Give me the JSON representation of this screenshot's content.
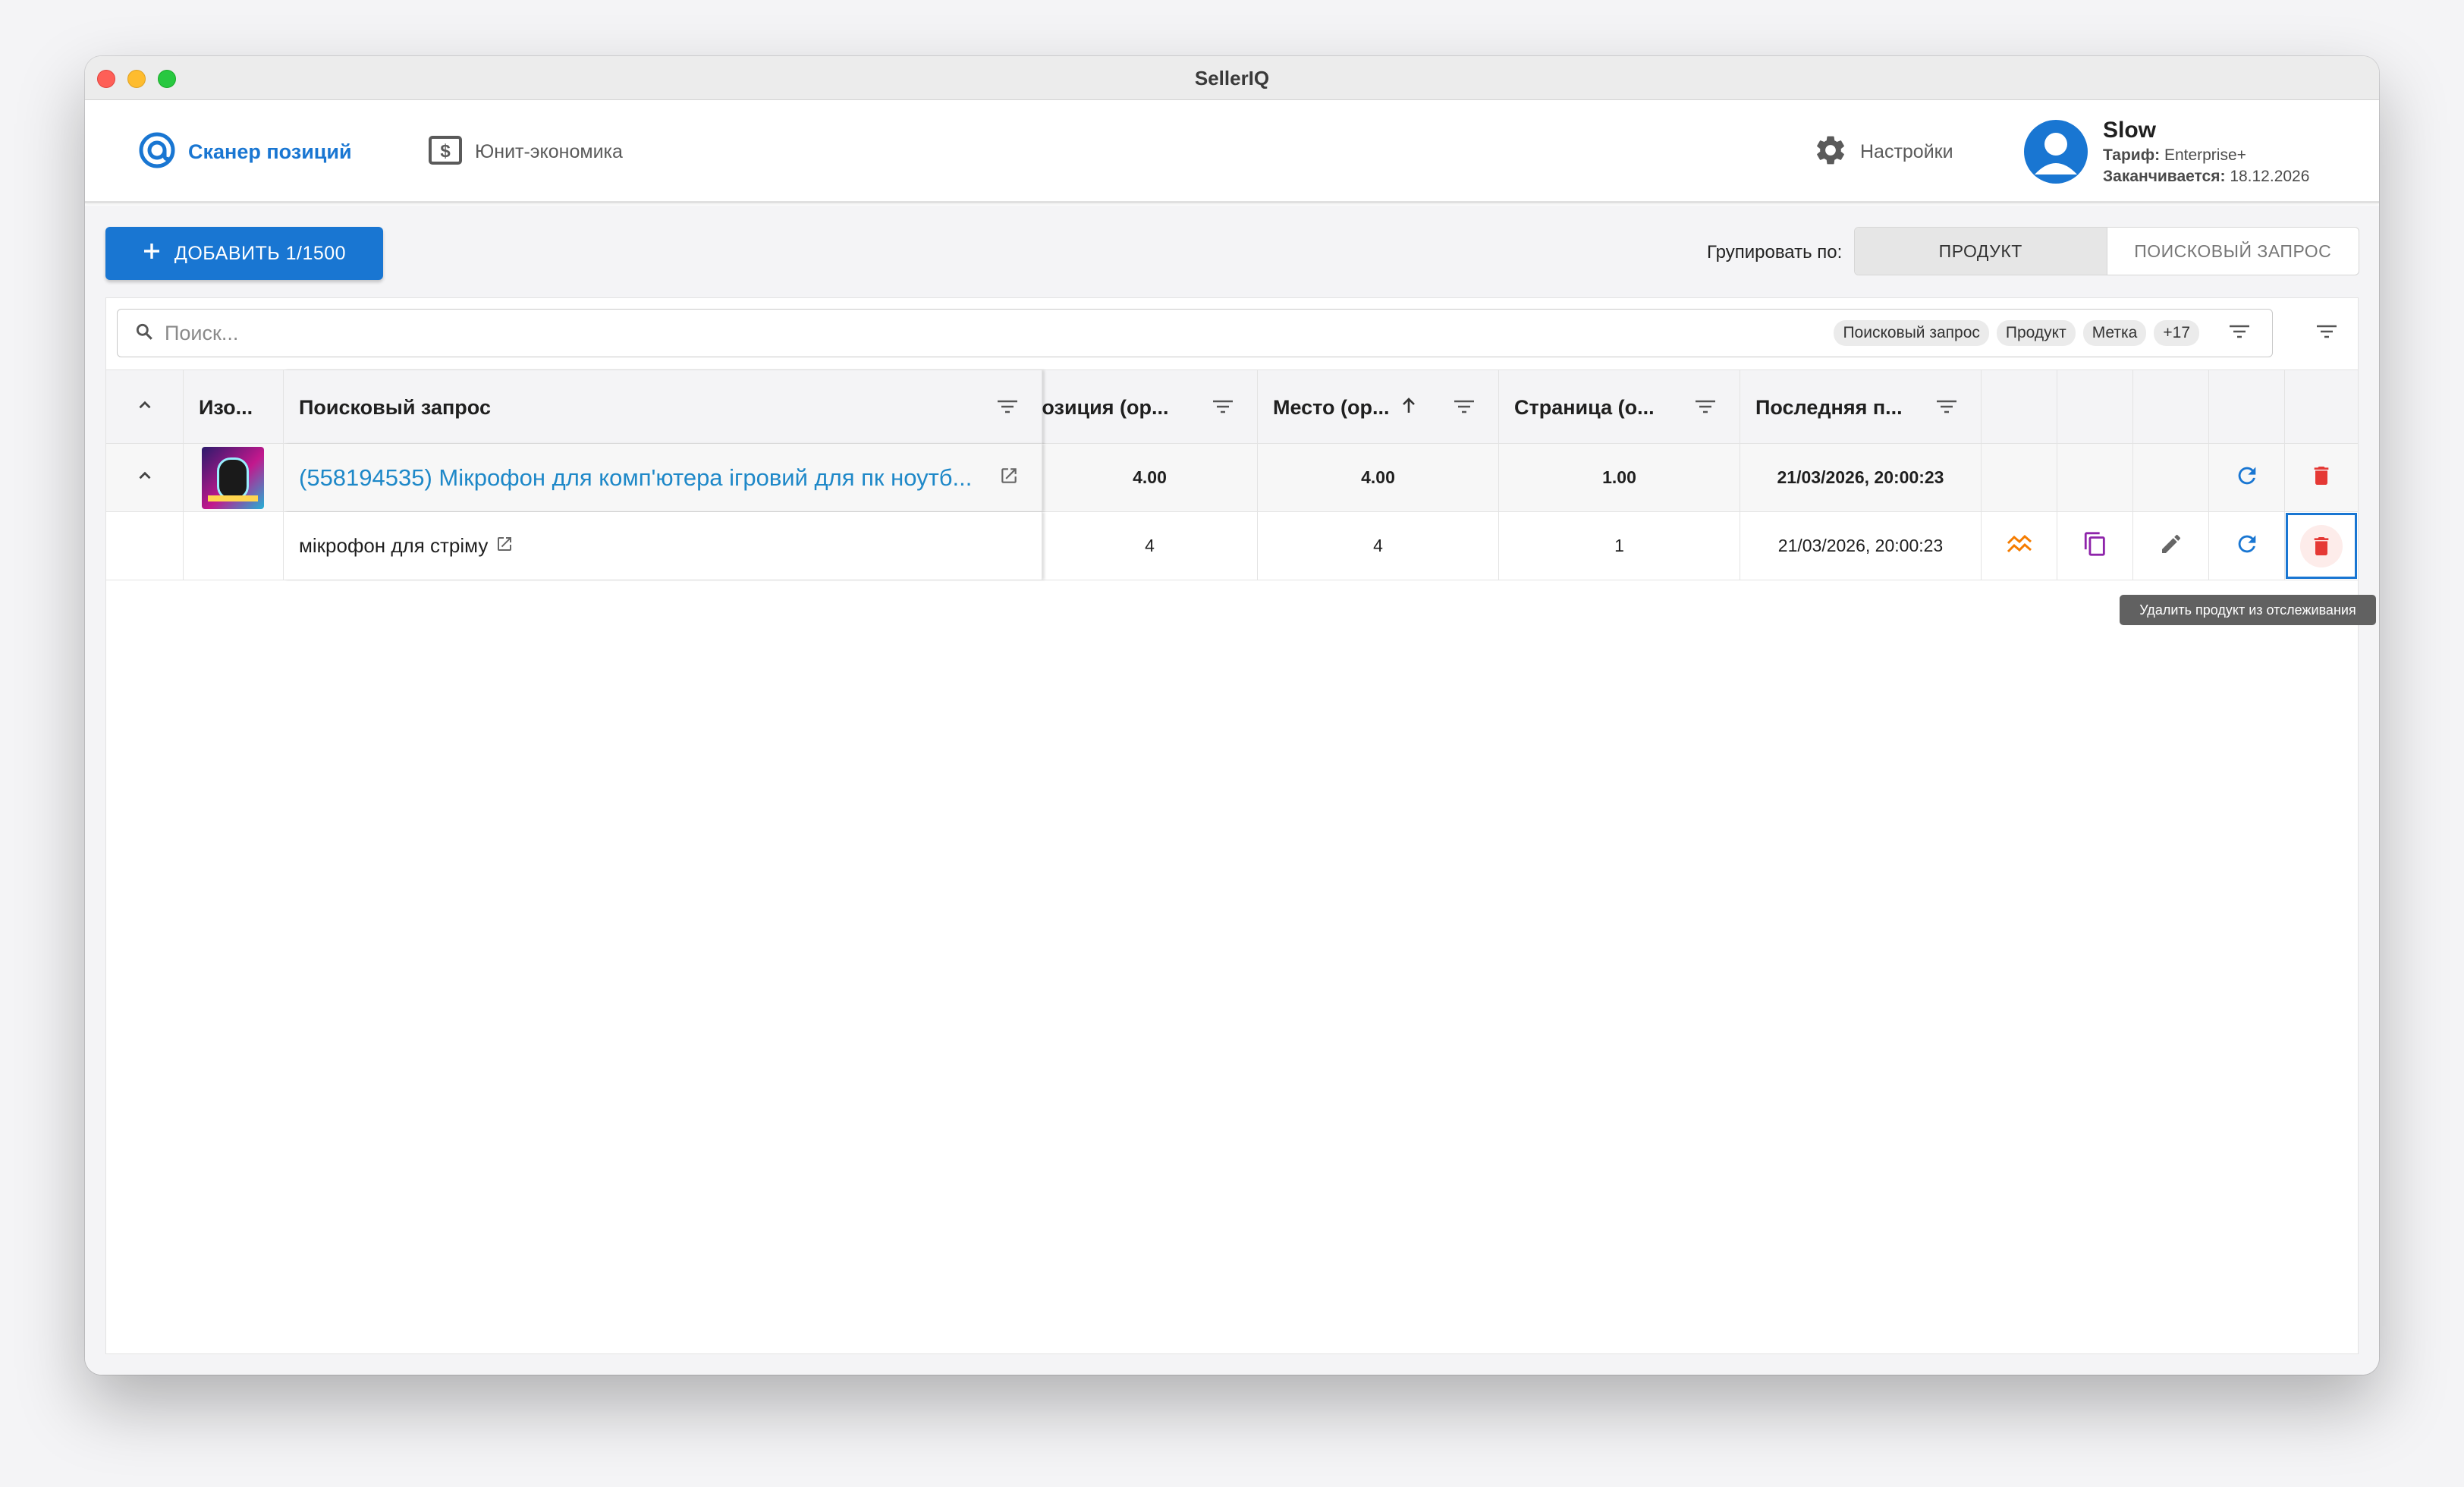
{
  "window": {
    "title": "SellerIQ"
  },
  "nav": {
    "scanner_label": "Сканер позиций",
    "unit_label": "Юнит-экономика",
    "settings_label": "Настройки"
  },
  "user": {
    "name": "Slow",
    "tariff_label": "Тариф:",
    "tariff_value": "Enterprise+",
    "expires_label": "Заканчивается:",
    "expires_value": "18.12.2026"
  },
  "toolbar": {
    "add_label": "ДОБАВИТЬ 1/1500",
    "group_label": "Групировать по:",
    "group_options": [
      "ПРОДУКТ",
      "ПОИСКОВЫЙ ЗАПРОС"
    ],
    "group_selected": "ПРОДУКТ"
  },
  "search": {
    "placeholder": "Поиск...",
    "chips": [
      "Поисковый запрос",
      "Продукт",
      "Метка",
      "+17"
    ]
  },
  "table": {
    "headers": {
      "image": "Изо...",
      "query": "Поисковый запрос",
      "position": "Позиция (ор...",
      "place": "Место (ор...",
      "page": "Страница (о...",
      "last": "Последняя п..."
    },
    "group_row": {
      "product": "(558194535) Мікрофон для комп'ютера ігровий для пк ноутб...",
      "position": "4.00",
      "place": "4.00",
      "page": "1.00",
      "last": "21/03/2026, 20:00:23"
    },
    "child_row": {
      "query": "мікрофон для стріму",
      "position": "4",
      "place": "4",
      "page": "1",
      "last": "21/03/2026, 20:00:23"
    }
  },
  "tooltip": {
    "text": "Удалить продукт из отслеживания"
  },
  "colors": {
    "primary": "#1976d2",
    "danger": "#e53935",
    "chart": "#f57c00",
    "copy": "#8e24aa",
    "link": "#1e88c8"
  },
  "icons": [
    "scanner-icon",
    "dollar-icon",
    "gear-icon",
    "user-avatar-icon",
    "plus-icon",
    "search-icon",
    "filter-icon",
    "chevron-up-icon",
    "external-link-icon",
    "refresh-icon",
    "trash-icon",
    "chart-icon",
    "copy-icon",
    "edit-icon",
    "sort-up-icon"
  ]
}
